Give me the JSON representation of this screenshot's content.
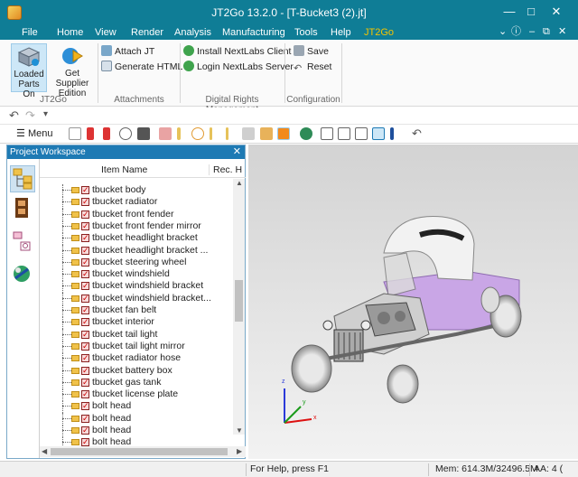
{
  "window": {
    "title": "JT2Go 13.2.0 - [T-Bucket3 (2).jt]",
    "controls": [
      "minimize-icon",
      "maximize-icon",
      "close-icon"
    ]
  },
  "menu": {
    "tabs": [
      "File",
      "Home",
      "View",
      "Render",
      "Analysis",
      "Manufacturing",
      "Tools",
      "Help",
      "JT2Go"
    ],
    "active_tab": "JT2Go"
  },
  "ribbon": {
    "groups": {
      "jt2go": "JT2Go",
      "attachments": "Attachments",
      "drm": "Digital Rights Management",
      "configuration": "Configuration"
    },
    "loaded_parts": "Loaded Parts On",
    "get_supplier": "Get Supplier Edition",
    "attach_jt": "Attach JT",
    "generate_html": "Generate HTML",
    "install_nextlabs": "Install NextLabs Client",
    "login_nextlabs": "Login NextLabs Server",
    "save": "Save",
    "reset": "Reset"
  },
  "toolbar": {
    "menu_label": "Menu"
  },
  "panel": {
    "title": "Project Workspace",
    "columns": {
      "item_name": "Item Name",
      "rec": "Rec. H"
    },
    "items": [
      "tbucket body",
      "tbucket radiator",
      "tbucket front fender",
      "tbucket front fender mirror",
      "tbucket headlight bracket",
      "tbucket headlight bracket ...",
      "tbucket steering wheel",
      "tbucket windshield",
      "tbucket windshield bracket",
      "tbucket windshield bracket...",
      "tbucket fan belt",
      "tbucket interior",
      "tbucket tail light",
      "tbucket tail light mirror",
      "tbucket radiator hose",
      "tbucket battery box",
      "tbucket gas tank",
      "tbucket license plate",
      "bolt head",
      "bolt head",
      "bolt head",
      "bolt head"
    ]
  },
  "axes": {
    "x": "x",
    "y": "y",
    "z": "z"
  },
  "status": {
    "help": "For Help, press F1",
    "memory": "Mem: 614.3M/32496.5M",
    "aa": "AA: 4 ("
  },
  "colors": {
    "accent": "#0f7d96",
    "active_tab": "#f3c300",
    "panel_title": "#1e7ab4",
    "car_body": "#c9a6e6"
  }
}
